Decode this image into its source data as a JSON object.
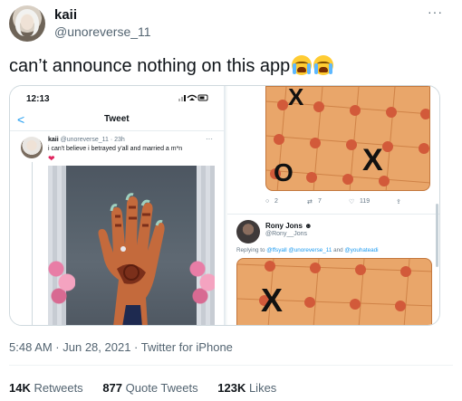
{
  "author": {
    "display_name": "kaii",
    "handle": "@unoreverse_11",
    "more_icon": "more-dots-icon"
  },
  "tweet_text": "can’t announce nothing on this app",
  "emojis": [
    "loudly-crying-face-emoji",
    "loudly-crying-face-emoji"
  ],
  "embedded": {
    "left": {
      "status_time": "12:13",
      "nav_title": "Tweet",
      "quoted": {
        "name": "kaii",
        "handle": "@unoreverse_11 · 23h",
        "text": "i can't believe i betrayed y'all and married a m*n",
        "emoji": "❤"
      }
    },
    "right": {
      "board_top_marks": [
        "X",
        "O",
        "X"
      ],
      "actions": {
        "replies": "2",
        "retweets": "7",
        "likes": "119"
      },
      "reply": {
        "name": "Rony Jons",
        "handle": "@Rony__Jons",
        "replying_prefix": "Replying to",
        "replying_mentions": "@ffsyall @unoreverse_11",
        "replying_and": "and",
        "replying_last": "@youhateadi"
      },
      "board_bottom_marks": [
        "X"
      ]
    }
  },
  "timestamp": "5:48 AM · Jun 28, 2021 · Twitter for iPhone",
  "stats": {
    "retweets_count": "14K",
    "retweets_label": "Retweets",
    "quotes_count": "877",
    "quotes_label": "Quote Tweets",
    "likes_count": "123K",
    "likes_label": "Likes"
  },
  "colors": {
    "accent": "#1d9bf0",
    "secondary_text": "#536471",
    "board_orange": "#e9a66a",
    "heart": "#e0245e"
  }
}
